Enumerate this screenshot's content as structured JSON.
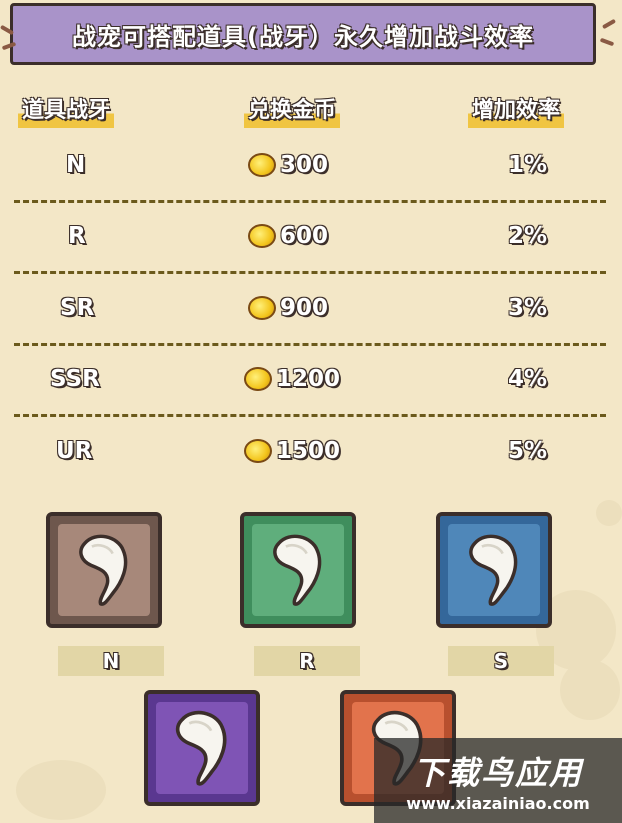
{
  "banner": {
    "title": "战宠可搭配道具(战牙）永久增加战斗效率"
  },
  "table": {
    "headers": [
      "道具战牙",
      "兑换金币",
      "增加效率"
    ],
    "rows": [
      {
        "grade": "N",
        "coins": "300",
        "rate": "1%"
      },
      {
        "grade": "R",
        "coins": "600",
        "rate": "2%"
      },
      {
        "grade": "SR",
        "coins": "900",
        "rate": "3%"
      },
      {
        "grade": "SSR",
        "coins": "1200",
        "rate": "4%"
      },
      {
        "grade": "UR",
        "coins": "1500",
        "rate": "5%"
      }
    ]
  },
  "cards": [
    {
      "label": "N",
      "color": "#a7887a"
    },
    {
      "label": "R",
      "color": "#5fae7c"
    },
    {
      "label": "S",
      "color": "#4f87b9"
    },
    {
      "label": "",
      "color": "#7f54b5"
    },
    {
      "label": "",
      "color": "#e2734c"
    }
  ],
  "watermark": {
    "cn": "下载鸟应用",
    "url": "www.xiazainiao.com"
  },
  "colors": {
    "background": "#f3e7c7",
    "banner": "#a993c9",
    "outline": "#3b2e2a",
    "coin": "#f3c51c"
  },
  "icons": {
    "coin": "gold-coin-icon",
    "item": "fang-icon"
  }
}
